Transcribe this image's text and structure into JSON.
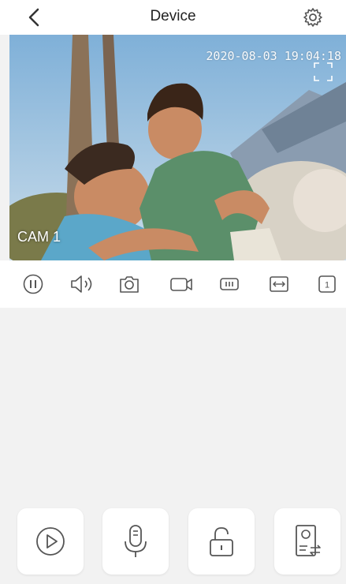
{
  "header": {
    "title": "Device",
    "back_icon": "chevron-left-icon",
    "settings_icon": "gear-icon"
  },
  "video": {
    "timestamp": "2020-08-03 19:04:18",
    "camera_label": "CAM 1",
    "fullscreen_icon": "fullscreen-icon"
  },
  "controls": {
    "items": [
      {
        "name": "pause",
        "icon": "pause-icon"
      },
      {
        "name": "speaker",
        "icon": "speaker-icon"
      },
      {
        "name": "snapshot",
        "icon": "camera-icon"
      },
      {
        "name": "record",
        "icon": "video-record-icon"
      },
      {
        "name": "quality",
        "icon": "quality-icon"
      },
      {
        "name": "stretch",
        "icon": "stretch-icon"
      },
      {
        "name": "channel",
        "icon": "channel-icon",
        "value": "1"
      }
    ]
  },
  "actions": [
    {
      "name": "playback",
      "icon": "play-circle-icon"
    },
    {
      "name": "talk",
      "icon": "microphone-icon"
    },
    {
      "name": "unlock",
      "icon": "unlock-icon"
    },
    {
      "name": "switch-device",
      "icon": "switch-device-icon"
    }
  ],
  "colors": {
    "icon": "#555555",
    "background": "#f2f2f2",
    "panel": "#ffffff"
  }
}
